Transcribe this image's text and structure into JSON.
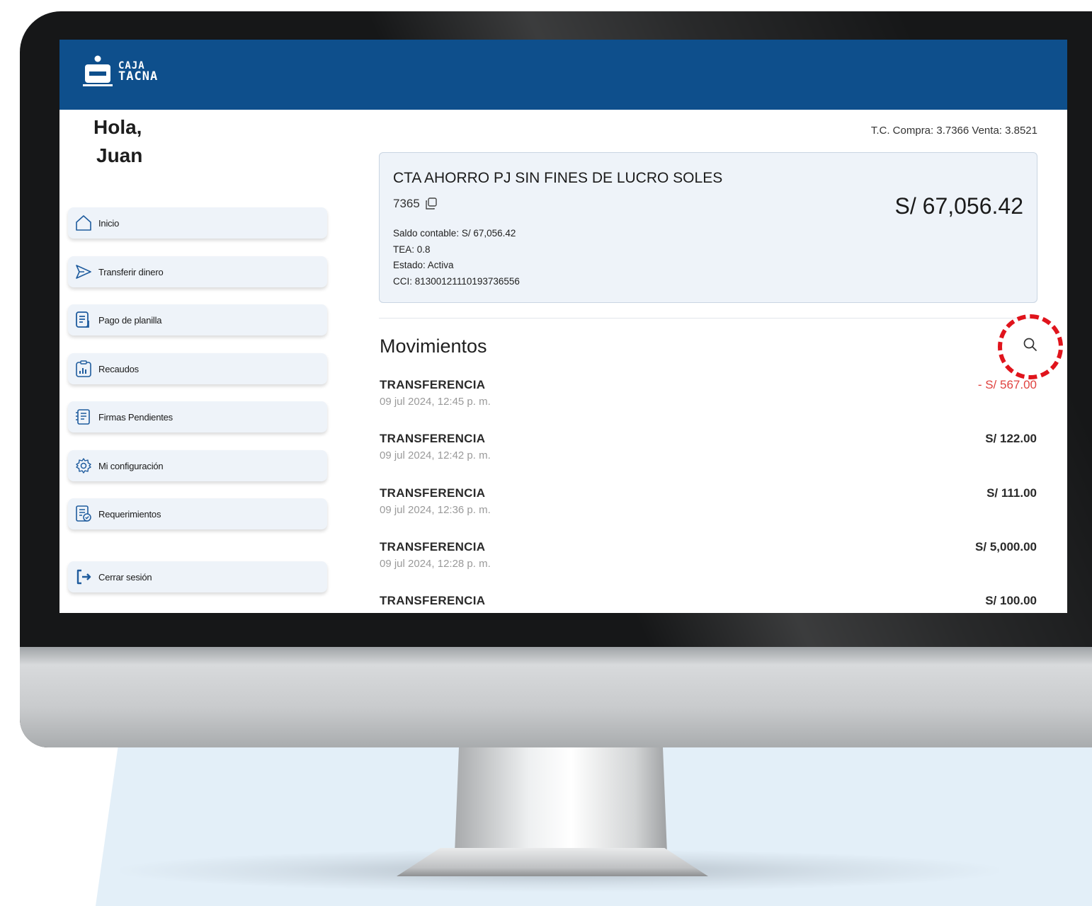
{
  "brand": {
    "logo_line1": "CAJA",
    "logo_line2": "TACNA",
    "primary_color": "#0e4f8c"
  },
  "greeting": {
    "hello": "Hola,",
    "name": "Juan"
  },
  "menu": {
    "items": [
      {
        "label": "Inicio",
        "icon": "home-icon"
      },
      {
        "label": "Transferir dinero",
        "icon": "send-icon"
      },
      {
        "label": "Pago de planilla",
        "icon": "document-icon"
      },
      {
        "label": "Recaudos",
        "icon": "chart-clipboard-icon"
      },
      {
        "label": "Firmas Pendientes",
        "icon": "signature-doc-icon"
      },
      {
        "label": "Mi configuración",
        "icon": "gear-icon"
      },
      {
        "label": "Requerimientos",
        "icon": "request-doc-icon"
      }
    ],
    "logout": {
      "label": "Cerrar sesión",
      "icon": "logout-icon"
    }
  },
  "exchange_rate": "T.C. Compra: 3.7366 Venta: 3.8521",
  "account": {
    "title": "CTA AHORRO PJ SIN FINES DE LUCRO SOLES",
    "number": "7365",
    "balance": "S/ 67,056.42",
    "saldo_contable": "Saldo contable: S/ 67,056.42",
    "tea": "TEA: 0.8",
    "estado": "Estado: Activa",
    "cci": "CCI: 81300121110193736556"
  },
  "movements": {
    "title": "Movimientos",
    "highlight_color": "#e0141c",
    "items": [
      {
        "kind": "TRANSFERENCIA",
        "date": "09 jul 2024, 12:45 p. m.",
        "amount": "- S/ 567.00",
        "negative": true
      },
      {
        "kind": "TRANSFERENCIA",
        "date": "09 jul 2024, 12:42 p. m.",
        "amount": "S/ 122.00",
        "negative": false
      },
      {
        "kind": "TRANSFERENCIA",
        "date": "09 jul 2024, 12:36 p. m.",
        "amount": "S/ 111.00",
        "negative": false
      },
      {
        "kind": "TRANSFERENCIA",
        "date": "09 jul 2024, 12:28 p. m.",
        "amount": "S/ 5,000.00",
        "negative": false
      },
      {
        "kind": "TRANSFERENCIA",
        "date": "",
        "amount": "S/ 100.00",
        "negative": false
      }
    ]
  }
}
